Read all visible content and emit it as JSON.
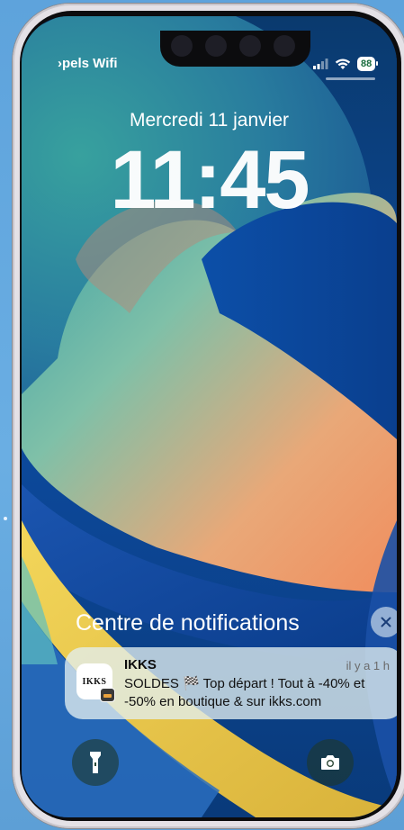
{
  "status_bar": {
    "carrier": "›pels Wifi",
    "battery": "88",
    "icons": [
      "cellular-signal-icon",
      "wifi-icon",
      "battery-icon"
    ]
  },
  "lock_screen": {
    "date": "Mercredi 11 janvier",
    "time": "11:45"
  },
  "notification_center": {
    "title": "Centre de notifications",
    "close_icon": "close-icon"
  },
  "notification": {
    "app_name": "IKKS",
    "app_icon_text": "IKKS",
    "time": "il y a 1 h",
    "body": "SOLDES 🏁 Top départ ! Tout à -40% et -50% en boutique & sur ikks.com"
  },
  "quick_actions": {
    "left_icon": "flashlight-icon",
    "right_icon": "camera-icon"
  },
  "colors": {
    "wallpaper_blue": "#0b3e86",
    "wallpaper_teal": "#5fb8b4",
    "wallpaper_orange": "#f0a070",
    "wallpaper_yellow": "#e8c94a",
    "battery_green": "#1a6d3f"
  }
}
